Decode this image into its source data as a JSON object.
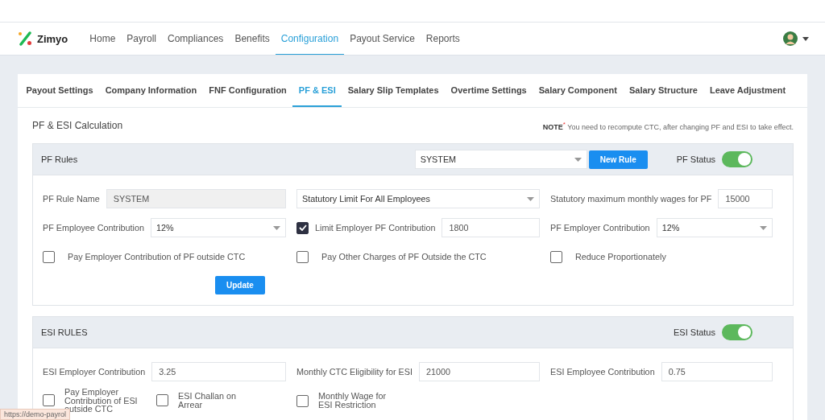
{
  "nav": {
    "brand": "Zimyo",
    "items": [
      {
        "label": "Home",
        "selected": false
      },
      {
        "label": "Payroll",
        "selected": false
      },
      {
        "label": "Compliances",
        "selected": false
      },
      {
        "label": "Benefits",
        "selected": false
      },
      {
        "label": "Configuration",
        "selected": true
      },
      {
        "label": "Payout Service",
        "selected": false
      },
      {
        "label": "Reports",
        "selected": false
      }
    ]
  },
  "tabs": [
    {
      "label": "Payout Settings",
      "selected": false
    },
    {
      "label": "Company Information",
      "selected": false
    },
    {
      "label": "FNF Configuration",
      "selected": false
    },
    {
      "label": "PF & ESI",
      "selected": true
    },
    {
      "label": "Salary Slip Templates",
      "selected": false
    },
    {
      "label": "Overtime Settings",
      "selected": false
    },
    {
      "label": "Salary Component",
      "selected": false
    },
    {
      "label": "Salary Structure",
      "selected": false
    },
    {
      "label": "Leave Adjustment",
      "selected": false
    }
  ],
  "page_title": "PF & ESI Calculation",
  "note": {
    "label": "NOTE",
    "mark": "*",
    "text": "You need to recompute CTC, after changing PF and ESI to take effect."
  },
  "sections": [
    {
      "title": "PF Rules",
      "rule_select": "SYSTEM",
      "new_rule_button": "New Rule",
      "status_label": "PF Status",
      "status_on": true,
      "rows": [
        [
          {
            "kind": "input",
            "label": "PF Rule Name",
            "value": "SYSTEM",
            "disabled": true
          },
          {
            "kind": "select",
            "value": "Statutory Limit For All Employees"
          },
          {
            "kind": "input",
            "label": "Statutory maximum monthly wages for PF",
            "value": "15000",
            "disabled": false
          }
        ],
        [
          {
            "kind": "select",
            "label": "PF Employee Contribution",
            "value": "12%"
          },
          {
            "kind": "check_input",
            "label": "Limit Employer PF Contribution",
            "checked": true,
            "value": "1800"
          },
          {
            "kind": "select",
            "label": "PF Employer Contribution",
            "value": "12%"
          }
        ],
        [
          {
            "kind": "checkbox",
            "label": "Pay Employer Contribution of PF outside CTC",
            "checked": false
          },
          {
            "kind": "checkbox",
            "label": "Pay Other Charges of PF Outside the CTC",
            "checked": false
          },
          {
            "kind": "checkbox",
            "label": "Reduce Proportionately",
            "checked": false
          }
        ]
      ],
      "update_button": "Update"
    },
    {
      "title": "ESI RULES",
      "status_label": "ESI Status",
      "status_on": true,
      "rows": [
        [
          {
            "kind": "input",
            "label": "ESI Employer Contribution",
            "value": "3.25",
            "disabled": false
          },
          {
            "kind": "input",
            "label": "Monthly CTC Eligibility for ESI",
            "value": "21000",
            "disabled": false
          },
          {
            "kind": "input",
            "label": "ESI Employee Contribution",
            "value": "0.75",
            "disabled": false
          }
        ],
        [
          {
            "kind": "checkbox_pair",
            "items": [
              {
                "label": "Pay Employer Contribution of ESI outside CTC",
                "checked": false
              },
              {
                "label": "ESI Challan on Arrear",
                "checked": false
              }
            ]
          },
          {
            "kind": "narrow_checkbox",
            "label": "Monthly Wage for ESI Restriction",
            "checked": false
          }
        ]
      ]
    }
  ],
  "link_preview": "https://demo-payrol"
}
